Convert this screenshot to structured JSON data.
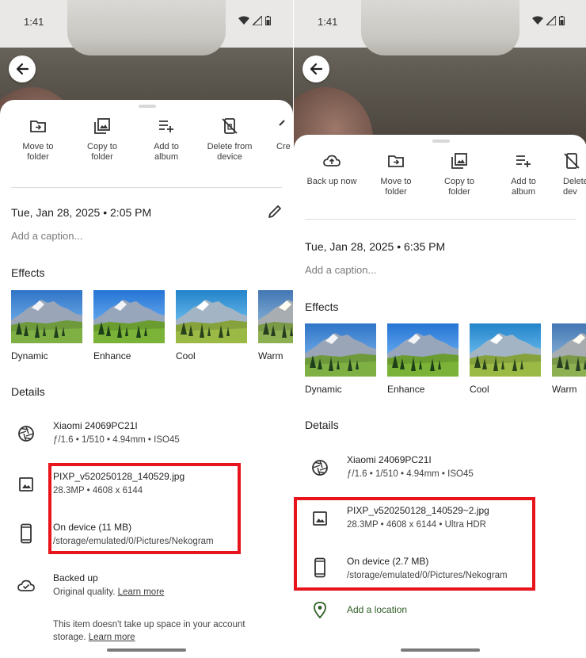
{
  "status_bar": {
    "time": "1:41"
  },
  "left": {
    "actions": [
      {
        "label": "Move to\nfolder",
        "icon": "folder-move-icon"
      },
      {
        "label": "Copy to\nfolder",
        "icon": "copy-folder-icon"
      },
      {
        "label": "Add to\nalbum",
        "icon": "add-album-icon"
      },
      {
        "label": "Delete from\ndevice",
        "icon": "delete-device-icon"
      },
      {
        "label": "Cre",
        "icon": "create-icon"
      }
    ],
    "date": "Tue, Jan 28, 2025  •  2:05 PM",
    "caption_placeholder": "Add a caption...",
    "effects_title": "Effects",
    "effects": [
      "Dynamic",
      "Enhance",
      "Cool",
      "Warm"
    ],
    "details_title": "Details",
    "camera": {
      "name": "Xiaomi 24069PC21I",
      "specs": "ƒ/1.6  •  1/510  •  4.94mm  •  ISO45"
    },
    "file": {
      "name": "PIXP_v520250128_140529.jpg",
      "specs": "28.3MP  •  4608 x 6144"
    },
    "storage": {
      "title": "On device (11 MB)",
      "path": "/storage/emulated/0/Pictures/Nekogram"
    },
    "backup": {
      "title": "Backed up",
      "quality": "Original quality.",
      "learn_more": "Learn more"
    },
    "storage_note": {
      "line1": "This item doesn't take up space in your account",
      "line2": "storage.",
      "learn_more": "Learn more"
    }
  },
  "right": {
    "actions": [
      {
        "label": "Back up now",
        "icon": "cloud-upload-icon"
      },
      {
        "label": "Move to\nfolder",
        "icon": "folder-move-icon"
      },
      {
        "label": "Copy to\nfolder",
        "icon": "copy-folder-icon"
      },
      {
        "label": "Add to\nalbum",
        "icon": "add-album-icon"
      },
      {
        "label": "Delete\ndev",
        "icon": "delete-device-icon"
      }
    ],
    "date": "Tue, Jan 28, 2025  •  6:35 PM",
    "caption_placeholder": "Add a caption...",
    "effects_title": "Effects",
    "effects": [
      "Dynamic",
      "Enhance",
      "Cool",
      "Warm"
    ],
    "details_title": "Details",
    "camera": {
      "name": "Xiaomi 24069PC21I",
      "specs": "ƒ/1.6  •  1/510  •  4.94mm  •  ISO45"
    },
    "file": {
      "name": "PIXP_v520250128_140529~2.jpg",
      "specs": "28.3MP  •  4608 x 6144  •  Ultra HDR"
    },
    "storage": {
      "title": "On device (2.7 MB)",
      "path": "/storage/emulated/0/Pictures/Nekogram"
    },
    "location": {
      "label": "Add a location"
    }
  },
  "colors": {
    "highlight_box": "#e8141c",
    "location_accent": "#2f5d26"
  }
}
